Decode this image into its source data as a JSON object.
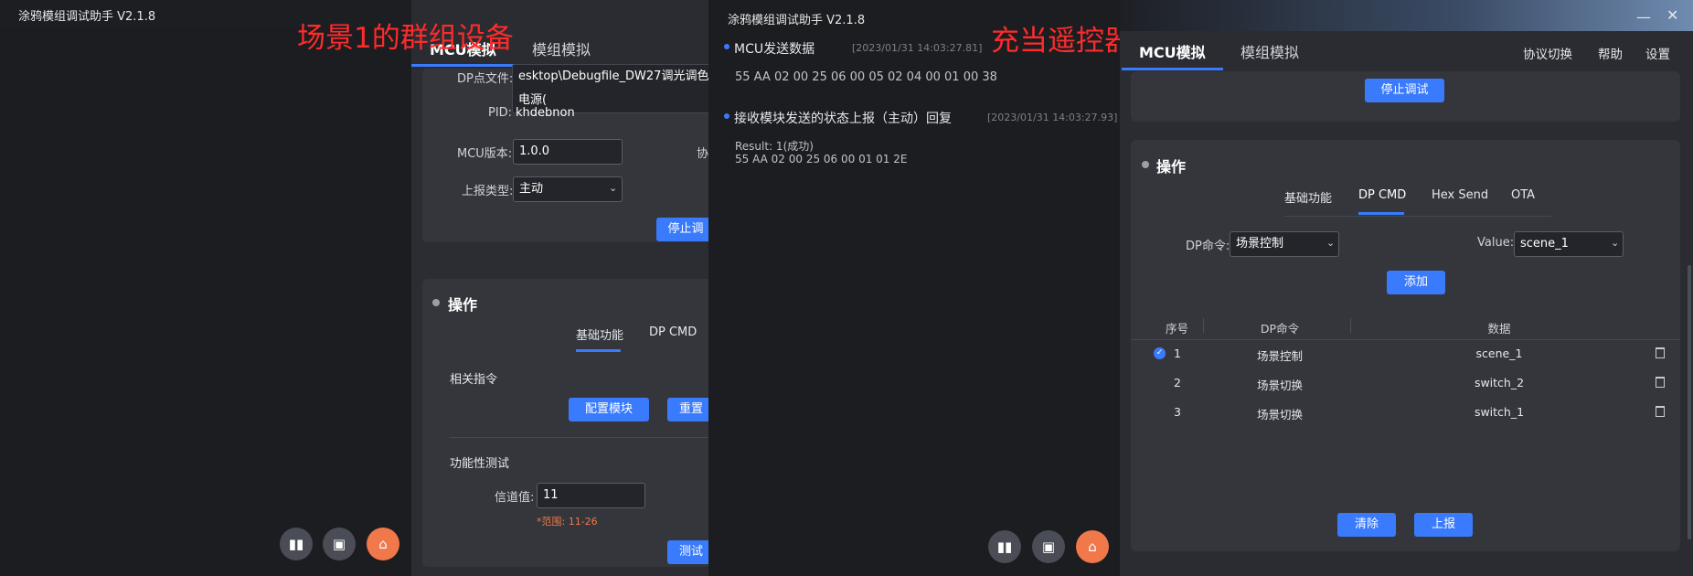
{
  "left_window": {
    "title": "涂鸦模组调试助手 V2.1.8",
    "note": "场景1的群组设备",
    "tabs": [
      "MCU模拟",
      "模组模拟"
    ],
    "config": {
      "dp_file_label": "DP点文件:",
      "dp_file_value": "esktop\\Debugfile_DW27调光调色电源(",
      "pid_label": "PID:",
      "pid_value": "khdebnon",
      "mcu_version_label": "MCU版本:",
      "mcu_version_value": "1.0.0",
      "protocol_partial": "协",
      "report_type_label": "上报类型:",
      "report_type_value": "主动",
      "stop_button": "停止调"
    },
    "operation": {
      "title": "操作",
      "subtabs": [
        "基础功能",
        "DP CMD"
      ],
      "related_cmd_label": "相关指令",
      "config_module_button": "配置模块",
      "reset_button": "重置",
      "func_test_label": "功能性测试",
      "channel_label": "信道值:",
      "channel_value": "11",
      "range_hint": "*范围: 11-26",
      "test_button": "测试"
    }
  },
  "middle_window": {
    "title": "涂鸦模组调试助手 V2.1.8",
    "note": "充当遥控器的设备",
    "log": [
      {
        "title": "MCU发送数据",
        "time": "[2023/01/31 14:03:27.81]",
        "lines": [
          "55 AA 02 00 25 06 00 05 02 04 00 01 00 38"
        ]
      },
      {
        "title": "接收模块发送的状态上报（主动）回复",
        "time": "[2023/01/31 14:03:27.93]",
        "lines": [
          "Result: 1(成功)",
          "55 AA 02 00 25 06 00 01 01 2E"
        ]
      }
    ]
  },
  "right_window": {
    "tabs": [
      "MCU模拟",
      "模组模拟"
    ],
    "menu": [
      "协议切换",
      "帮助",
      "设置"
    ],
    "stop_button": "停止调试",
    "operation": {
      "title": "操作",
      "subtabs": [
        "基础功能",
        "DP CMD",
        "Hex Send",
        "OTA"
      ],
      "dp_cmd_label": "DP命令:",
      "dp_cmd_value": "场景控制",
      "value_label": "Value:",
      "value_value": "scene_1",
      "add_button": "添加",
      "table_headers": [
        "序号",
        "DP命令",
        "数据"
      ],
      "rows": [
        {
          "no": "1",
          "cmd": "场景控制",
          "data": "scene_1"
        },
        {
          "no": "2",
          "cmd": "场景切换",
          "data": "switch_2"
        },
        {
          "no": "3",
          "cmd": "场景切换",
          "data": "switch_1"
        }
      ],
      "clear_button": "清除",
      "report_button": "上报"
    }
  },
  "colors": {
    "accent": "#3a7bfd",
    "note_red": "#ff2b2b",
    "orange": "#f0784a"
  },
  "icons": [
    "chart-icon",
    "save-icon",
    "broom-icon",
    "minimize-icon",
    "close-icon"
  ]
}
